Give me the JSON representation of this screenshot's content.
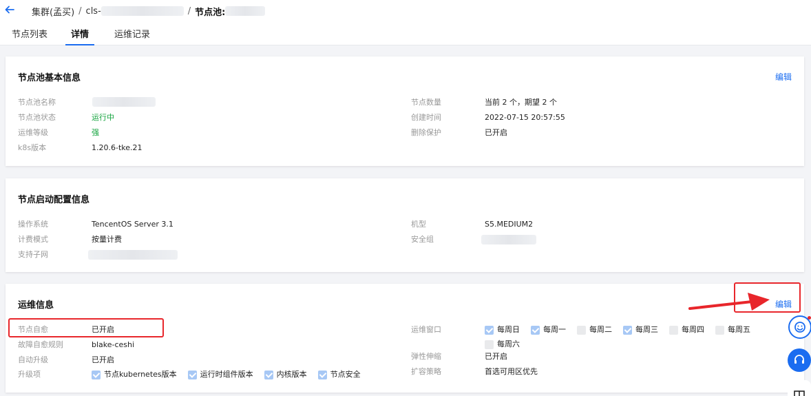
{
  "breadcrumb": {
    "cluster": "集群(孟买)",
    "sep1": "/",
    "cluster_id_prefix": "cls-",
    "sep2": "/",
    "nodepool_prefix": "节点池:"
  },
  "tabs": [
    {
      "label": "节点列表"
    },
    {
      "label": "详情"
    },
    {
      "label": "运维记录"
    }
  ],
  "basic": {
    "title": "节点池基本信息",
    "edit": "编辑",
    "left": [
      {
        "label": "节点池名称",
        "value": ""
      },
      {
        "label": "节点池状态",
        "value": "运行中"
      },
      {
        "label": "运维等级",
        "value": "强"
      },
      {
        "label": "k8s版本",
        "value": "1.20.6-tke.21"
      }
    ],
    "right": [
      {
        "label": "节点数量",
        "value": "当前 2 个，期望 2 个"
      },
      {
        "label": "创建时间",
        "value": "2022-07-15 20:57:55"
      },
      {
        "label": "删除保护",
        "value": "已开启"
      }
    ]
  },
  "launch": {
    "title": "节点启动配置信息",
    "left": [
      {
        "label": "操作系统",
        "value": "TencentOS Server 3.1"
      },
      {
        "label": "计费模式",
        "value": "按量计费"
      },
      {
        "label": "支持子网",
        "value": ""
      }
    ],
    "right": [
      {
        "label": "机型",
        "value": "S5.MEDIUM2"
      },
      {
        "label": "安全组",
        "value": ""
      }
    ]
  },
  "ops": {
    "title": "运维信息",
    "edit": "编辑",
    "left": [
      {
        "label": "节点自愈",
        "value": "已开启"
      },
      {
        "label": "故障自愈规则",
        "value": "blake-ceshi"
      },
      {
        "label": "自动升级",
        "value": "已开启"
      },
      {
        "label": "升级项",
        "value": ""
      }
    ],
    "upgrade_items": [
      {
        "label": "节点kubernetes版本",
        "checked": true
      },
      {
        "label": "运行时组件版本",
        "checked": true
      },
      {
        "label": "内核版本",
        "checked": true
      },
      {
        "label": "节点安全",
        "checked": true
      }
    ],
    "right": [
      {
        "label": "运维窗口",
        "value": ""
      },
      {
        "label": "弹性伸缩",
        "value": "已开启"
      },
      {
        "label": "扩容策略",
        "value": "首选可用区优先"
      }
    ],
    "window_days": [
      {
        "label": "每周日",
        "checked": true
      },
      {
        "label": "每周一",
        "checked": true
      },
      {
        "label": "每周二",
        "checked": false
      },
      {
        "label": "每周三",
        "checked": true
      },
      {
        "label": "每周四",
        "checked": false
      },
      {
        "label": "每周五",
        "checked": false
      },
      {
        "label": "每周六",
        "checked": false
      }
    ]
  },
  "colors": {
    "accent": "#1a6cf0",
    "success": "#13a33d",
    "highlight": "#e8262b"
  }
}
